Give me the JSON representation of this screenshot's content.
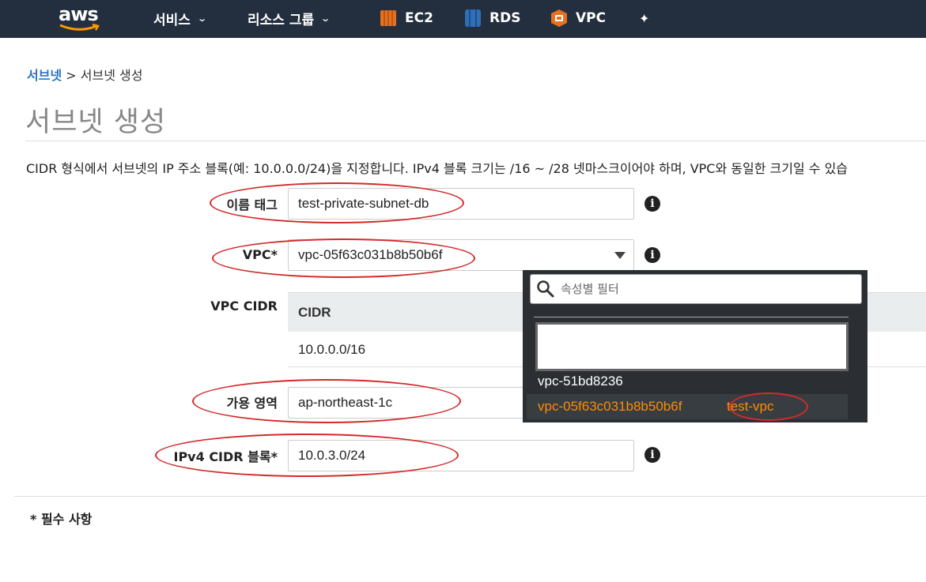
{
  "nav": {
    "logo": "aws",
    "services": "서비스",
    "resource_groups": "리소스 그룹",
    "ec2": "EC2",
    "rds": "RDS",
    "vpc": "VPC",
    "pin_icon": "pin-icon",
    "colors": {
      "bar": "#232f3e",
      "ec2": "#e7701e",
      "rds": "#2e6fb8",
      "vpc": "#e7701e",
      "smile": "#f90"
    }
  },
  "breadcrumb": {
    "parent": "서브넷",
    "separator": " > ",
    "current": "서브넷 생성"
  },
  "page": {
    "title": "서브넷 생성",
    "description": "CIDR 형식에서 서브넷의 IP 주소 블록(예: 10.0.0.0/24)을 지정합니다. IPv4 블록 크기는 /16 ~ /28 넷마스크이어야 하며, VPC와 동일한 크기일 수 있습"
  },
  "form": {
    "name_tag": {
      "label": "이름 태그",
      "value": "test-private-subnet-db"
    },
    "vpc": {
      "label": "VPC*",
      "value": "vpc-05f63c031b8b50b6f"
    },
    "vpc_cidr": {
      "label": "VPC CIDR",
      "header": "CIDR",
      "value": "10.0.0.0/16"
    },
    "az": {
      "label": "가용 영역",
      "value": "ap-northeast-1c"
    },
    "ipv4": {
      "label": "IPv4 CIDR 블록*",
      "value": "10.0.3.0/24"
    },
    "info_icon": "i"
  },
  "dropdown": {
    "placeholder": "속성별 필터",
    "options": [
      {
        "id": "vpc-51bd8236",
        "tag": ""
      },
      {
        "id": "vpc-05f63c031b8b50b6f",
        "tag": "test-vpc"
      }
    ],
    "colors": {
      "bg": "#2b2f33",
      "selected_text": "#ff8c00",
      "text": "#ffffff"
    }
  },
  "footer": {
    "required_note": "* 필수 사항"
  },
  "annotation_color": "#d42a2a"
}
